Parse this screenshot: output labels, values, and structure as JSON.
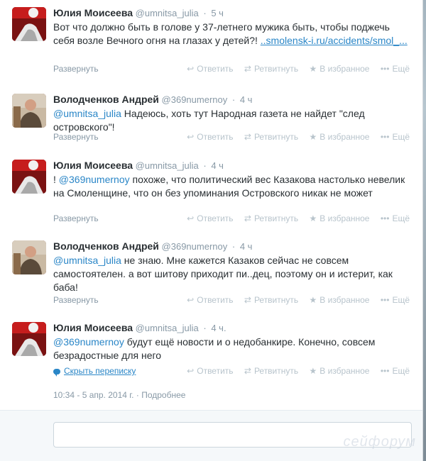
{
  "tweets": [
    {
      "name": "Юлия Моисеева",
      "handle": "@umnitsa_julia",
      "time": "5 ч",
      "text_plain": "Вот что должно быть в голове у 37-летнего мужика быть, чтобы поджечь себя возле Вечного огня на глазах у детей?! ",
      "link": "..smolensk-i.ru/accidents/smol_...",
      "expand": "Развернуть",
      "avatar": "woman-red-avatar"
    },
    {
      "name": "Володченков Андрей",
      "handle": "@369numernoy",
      "time": "4 ч",
      "mention": "@umnitsa_julia",
      "text_plain": " Надеюсь, хоть тут Народная газета не найдет \"след островского\"!",
      "expand": "Развернуть",
      "avatar": "man-avatar"
    },
    {
      "name": "Юлия Моисеева",
      "handle": "@umnitsa_julia",
      "time": "4 ч",
      "prefix": "! ",
      "mention": "@369numernoy",
      "text_plain": " похоже, что политический вес Казакова настолько невелик на Смоленщине, что он без упоминания Островского никак не может",
      "expand": "Развернуть",
      "avatar": "woman-red-avatar"
    },
    {
      "name": "Володченков Андрей",
      "handle": "@369numernoy",
      "time": "4 ч",
      "mention": "@umnitsa_julia",
      "text_plain": " не знаю. Мне кажется Казаков сейчас не совсем самостоятелен. а вот шитову приходит пи..дец, поэтому он и истерит, как баба!",
      "expand": "Развернуть",
      "avatar": "man-avatar"
    },
    {
      "name": "Юлия Моисеева",
      "handle": "@umnitsa_julia",
      "time": "4 ч.",
      "mention": "@369numernoy",
      "text_plain": " будут ещё новости и о недобанкире. Конечно, совсем безрадостные для него",
      "hide_conversation": "Скрыть переписку",
      "timestamp": "10:34 - 5 апр. 2014 г.",
      "details": "Подробнее",
      "avatar": "woman-red-avatar"
    }
  ],
  "actions": {
    "reply": "Ответить",
    "retweet": "Ретвитнуть",
    "favorite": "В избранное",
    "more": "Ещё"
  },
  "watermark": "сейфорум",
  "colors": {
    "link": "#2a86c7",
    "muted": "#8899a6",
    "text": "#292f33",
    "avatar_red": "#6b0f10"
  }
}
